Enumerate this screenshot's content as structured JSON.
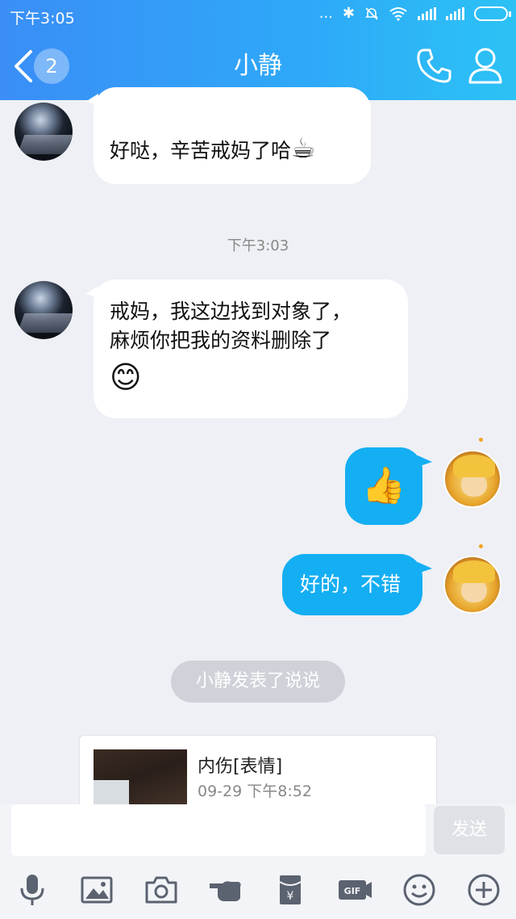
{
  "status_bar": {
    "time": "下午3:05",
    "dots": "...",
    "bluetooth": "✱"
  },
  "header": {
    "unread_count": "2",
    "title": "小静"
  },
  "messages": [
    {
      "text": "好哒，辛苦戒妈了哈",
      "emoji": "☕",
      "side": "left"
    },
    {
      "timestamp": "下午3:03"
    },
    {
      "line1": "戒妈，我这边找到对象了，",
      "line2": "麻烦你把我的资料删除了",
      "emoji": "😊",
      "side": "left"
    },
    {
      "emoji": "👍",
      "side": "right"
    },
    {
      "text": "好的，不错",
      "side": "right"
    }
  ],
  "system_notice": "小静发表了说说",
  "feed_card": {
    "title": "内伤[表情]",
    "time": "09-29 下午8:52"
  },
  "input": {
    "placeholder": "",
    "send_label": "发送"
  },
  "toolbar": [
    "microphone-icon",
    "image-icon",
    "camera-icon",
    "poke-icon",
    "red-packet-icon",
    "gif-icon",
    "emoji-icon",
    "plus-icon"
  ],
  "colors": {
    "header_start": "#3a8ef6",
    "header_end": "#2cc2f5",
    "bubble_right": "#14aef3",
    "bubble_left": "#ffffff",
    "background": "#eef0f5"
  }
}
